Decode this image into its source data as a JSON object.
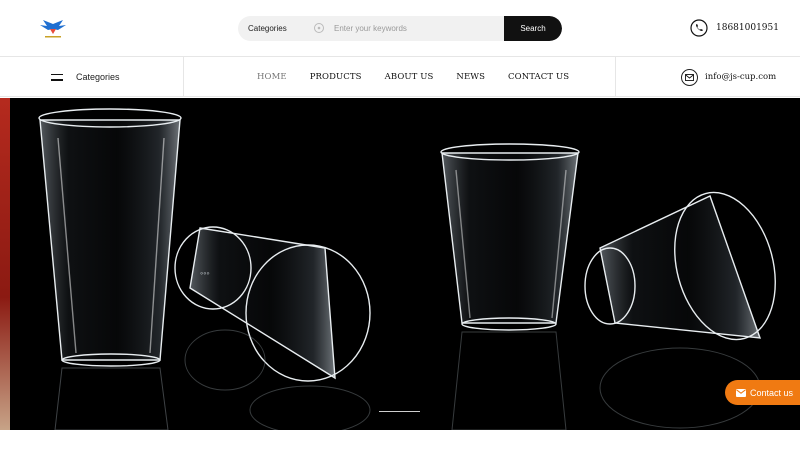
{
  "header": {
    "logo_icon": "eagle-logo-icon",
    "search": {
      "category_label": "Categories",
      "placeholder": "Enter your keywords",
      "button_label": "Search"
    },
    "phone": "18681001951"
  },
  "nav": {
    "categories_label": "Categories",
    "items": [
      {
        "label": "HOME",
        "active": true
      },
      {
        "label": "PRODUCTS"
      },
      {
        "label": "ABOUT US"
      },
      {
        "label": "NEWS"
      },
      {
        "label": "CONTACT US"
      }
    ],
    "email": "info@js-cup.com"
  },
  "hero": {
    "image_subject": "clear plastic cups on black background",
    "accent_color": "#f07a12"
  },
  "float_contact": {
    "label": "Contact us"
  }
}
